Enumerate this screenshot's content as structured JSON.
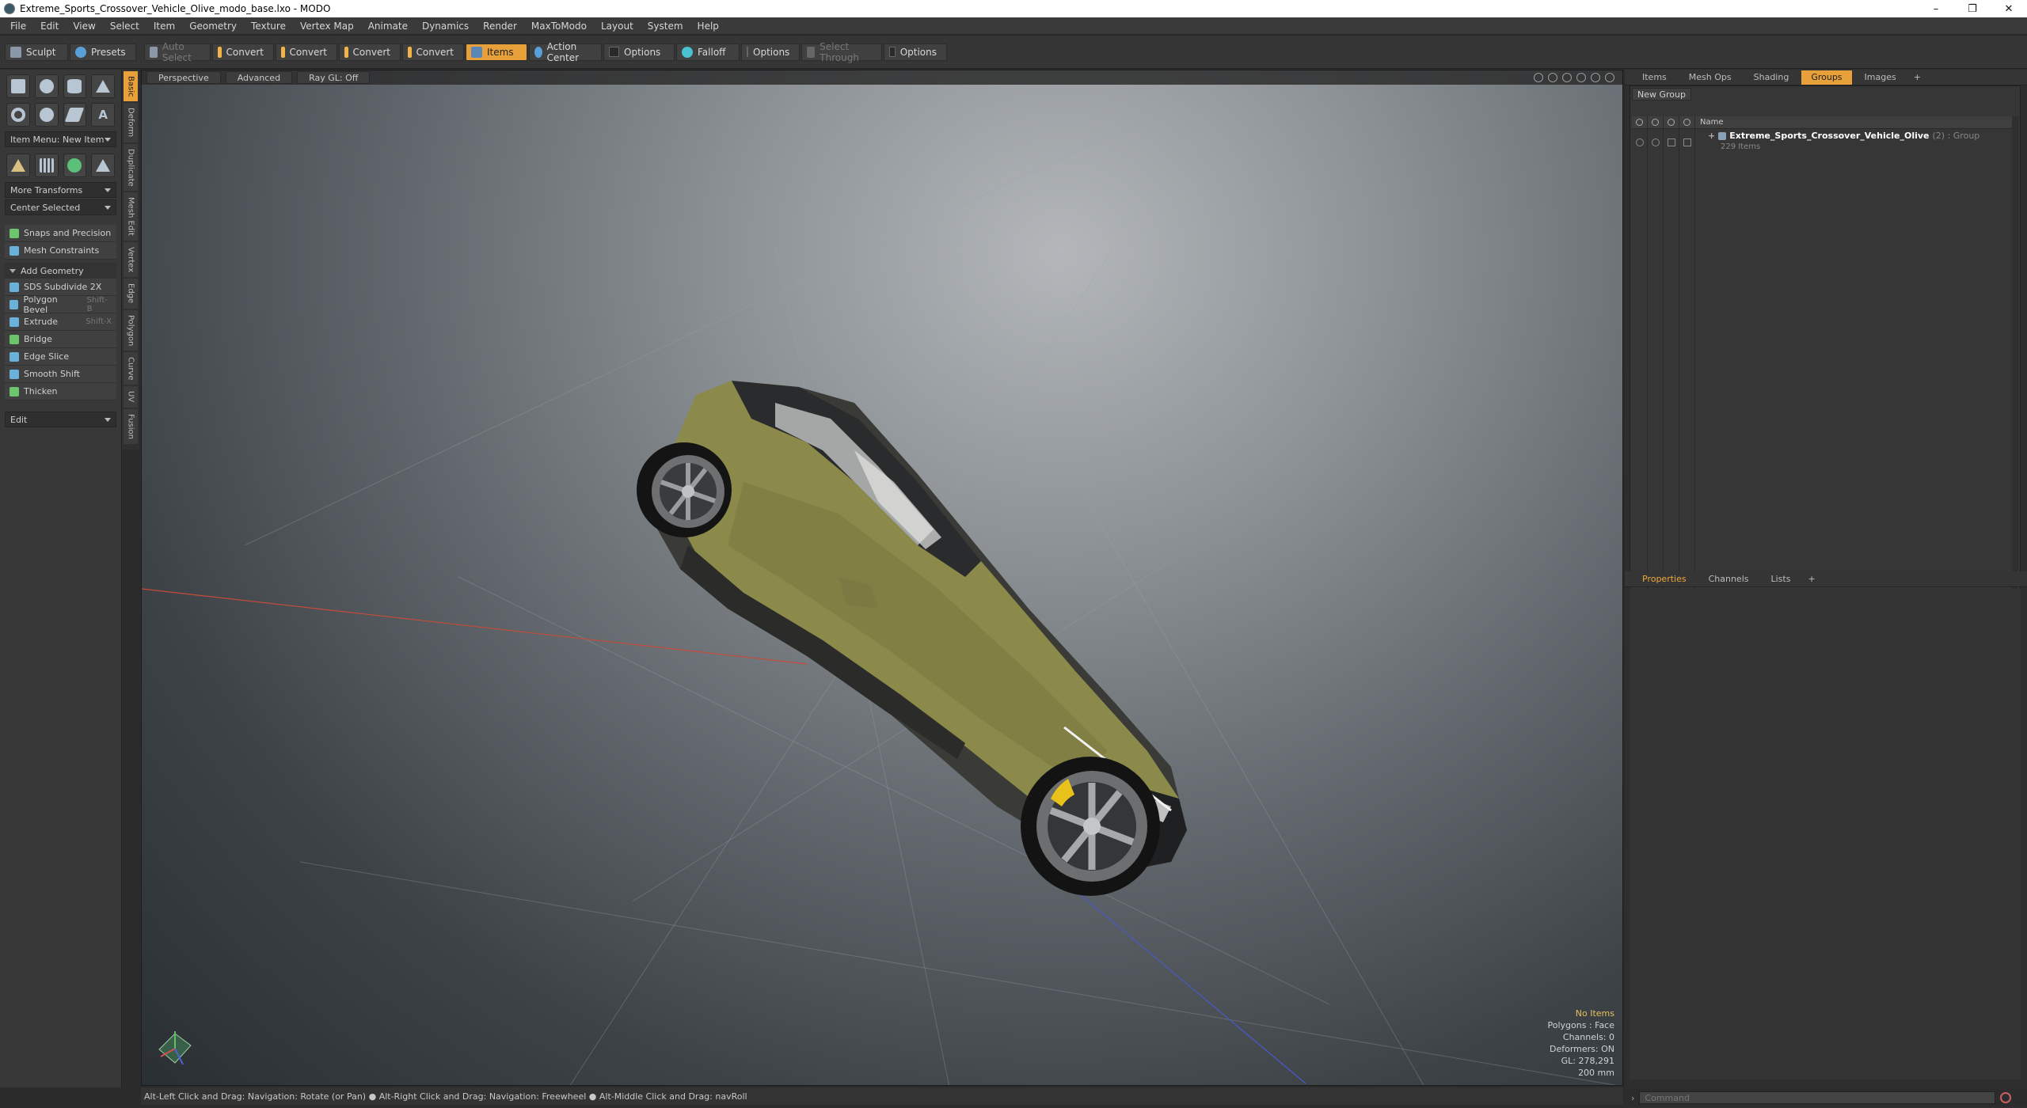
{
  "window": {
    "title": "Extreme_Sports_Crossover_Vehicle_Olive_modo_base.lxo - MODO"
  },
  "menu": [
    "File",
    "Edit",
    "View",
    "Select",
    "Item",
    "Geometry",
    "Texture",
    "Vertex Map",
    "Animate",
    "Dynamics",
    "Render",
    "MaxToModo",
    "Layout",
    "System",
    "Help"
  ],
  "toolbar": {
    "sculpt": "Sculpt",
    "presets": "Presets",
    "auto_select": "Auto Select",
    "convert1": "Convert",
    "convert2": "Convert",
    "convert3": "Convert",
    "convert4": "Convert",
    "items": "Items",
    "action_center": "Action Center",
    "options1": "Options",
    "falloff": "Falloff",
    "options2": "Options",
    "select_through": "Select Through",
    "options3": "Options"
  },
  "left": {
    "item_menu": "Item Menu: New Item",
    "more_transforms": "More Transforms",
    "center_selected": "Center Selected",
    "snaps": "Snaps and Precision",
    "mesh_constraints": "Mesh Constraints",
    "add_geometry": "Add Geometry",
    "tools": [
      {
        "label": "SDS Subdivide 2X",
        "shortcut": ""
      },
      {
        "label": "Polygon Bevel",
        "shortcut": "Shift-B"
      },
      {
        "label": "Extrude",
        "shortcut": "Shift-X"
      },
      {
        "label": "Bridge",
        "shortcut": ""
      },
      {
        "label": "Edge Slice",
        "shortcut": ""
      },
      {
        "label": "Smooth Shift",
        "shortcut": ""
      },
      {
        "label": "Thicken",
        "shortcut": ""
      }
    ],
    "edit": "Edit"
  },
  "vtabs": [
    "Basic",
    "Deform",
    "Duplicate",
    "Mesh Edit",
    "Vertex",
    "Edge",
    "Polygon",
    "Curve",
    "UV",
    "Fusion"
  ],
  "viewport": {
    "tabs": [
      "Perspective",
      "Advanced",
      "Ray GL: Off"
    ],
    "info": {
      "no_items": "No Items",
      "polygons": "Polygons : Face",
      "channels": "Channels: 0",
      "deformers": "Deformers: ON",
      "gl": "GL: 278,291",
      "scale": "200 mm"
    }
  },
  "status": "Alt-Left Click and Drag: Navigation: Rotate (or Pan) ● Alt-Right Click and Drag: Navigation: Freewheel ● Alt-Middle Click and Drag: navRoll",
  "right": {
    "tabs": [
      "Items",
      "Mesh Ops",
      "Shading",
      "Groups",
      "Images",
      "+"
    ],
    "new_group": "New Group",
    "col_name": "Name",
    "group": {
      "name": "Extreme_Sports_Crossover_Vehicle_Olive",
      "suffix": "(2) : Group",
      "count": "229 Items"
    },
    "props_tabs": [
      "Properties",
      "Channels",
      "Lists",
      "+"
    ]
  },
  "command": {
    "placeholder": "Command"
  },
  "colors": {
    "accent": "#e8a13a",
    "car_body": "#8c8a4a"
  }
}
